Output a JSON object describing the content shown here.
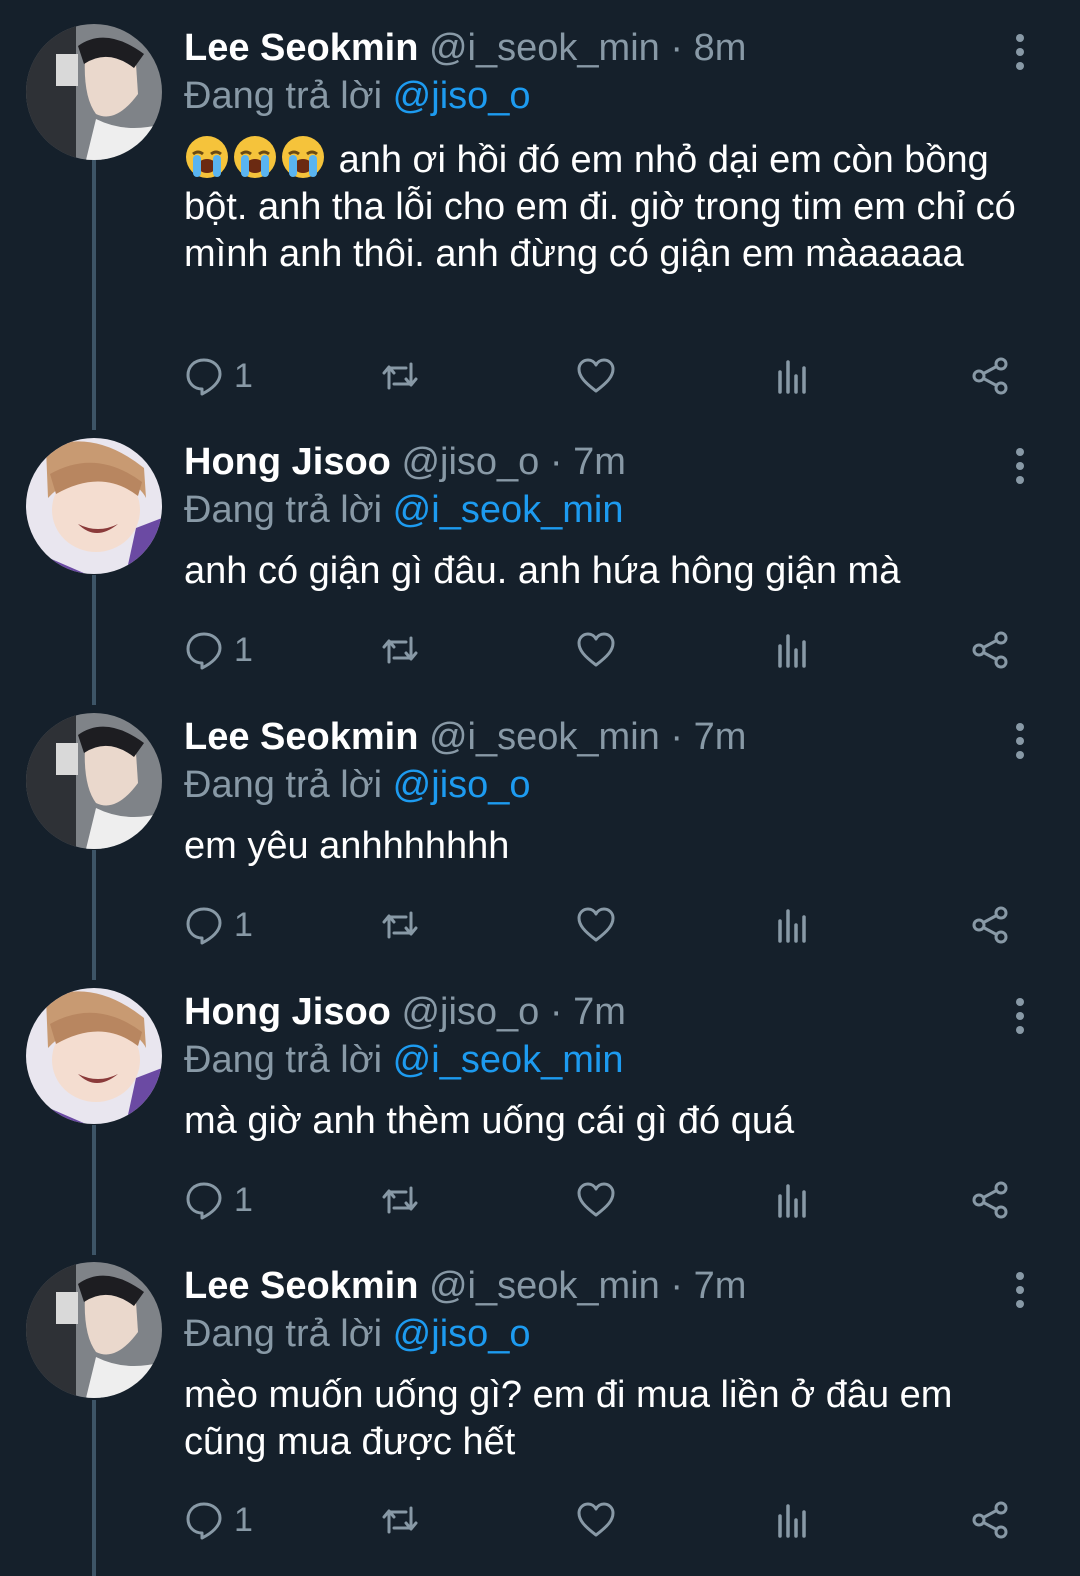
{
  "tweets": [
    {
      "name": "Lee Seokmin",
      "handle": "@i_seok_min",
      "separator": "·",
      "time": "8m",
      "reply_label": "Đang trả lời",
      "reply_to": "@jiso_o",
      "emoji": [
        "😭",
        "😭",
        "😭"
      ],
      "text": "anh ơi hồi đó em nhỏ dại em còn bồng bột. anh tha lỗi cho em đi. giờ trong tim em chỉ có mình anh thôi. anh đừng có giận em màaaaaa",
      "reply_count": "1",
      "avatar_icon": "avatar-lee-seokmin"
    },
    {
      "name": "Hong Jisoo",
      "handle": "@jiso_o",
      "separator": "·",
      "time": "7m",
      "reply_label": "Đang trả lời",
      "reply_to": "@i_seok_min",
      "text": "anh có giận gì đâu. anh hứa hông giận mà",
      "reply_count": "1",
      "avatar_icon": "avatar-hong-jisoo"
    },
    {
      "name": "Lee Seokmin",
      "handle": "@i_seok_min",
      "separator": "·",
      "time": "7m",
      "reply_label": "Đang trả lời",
      "reply_to": "@jiso_o",
      "text": "em yêu anhhhhhhh",
      "reply_count": "1",
      "avatar_icon": "avatar-lee-seokmin"
    },
    {
      "name": "Hong Jisoo",
      "handle": "@jiso_o",
      "separator": "·",
      "time": "7m",
      "reply_label": "Đang trả lời",
      "reply_to": "@i_seok_min",
      "text": "mà giờ anh thèm uống cái gì đó quá",
      "reply_count": "1",
      "avatar_icon": "avatar-hong-jisoo"
    },
    {
      "name": "Lee Seokmin",
      "handle": "@i_seok_min",
      "separator": "·",
      "time": "7m",
      "reply_label": "Đang trả lời",
      "reply_to": "@jiso_o",
      "text": "mèo muốn uống gì? em đi mua liền ở đâu em cũng mua được hết",
      "reply_count": "1",
      "avatar_icon": "avatar-lee-seokmin"
    }
  ],
  "action_icons": [
    "reply-icon",
    "retweet-icon",
    "like-icon",
    "analytics-icon",
    "share-icon"
  ],
  "colors": {
    "background": "#15202b",
    "text": "#ffffff",
    "secondary": "#8899a6",
    "mention": "#1d9bf0",
    "thread_line": "#3d5466"
  }
}
